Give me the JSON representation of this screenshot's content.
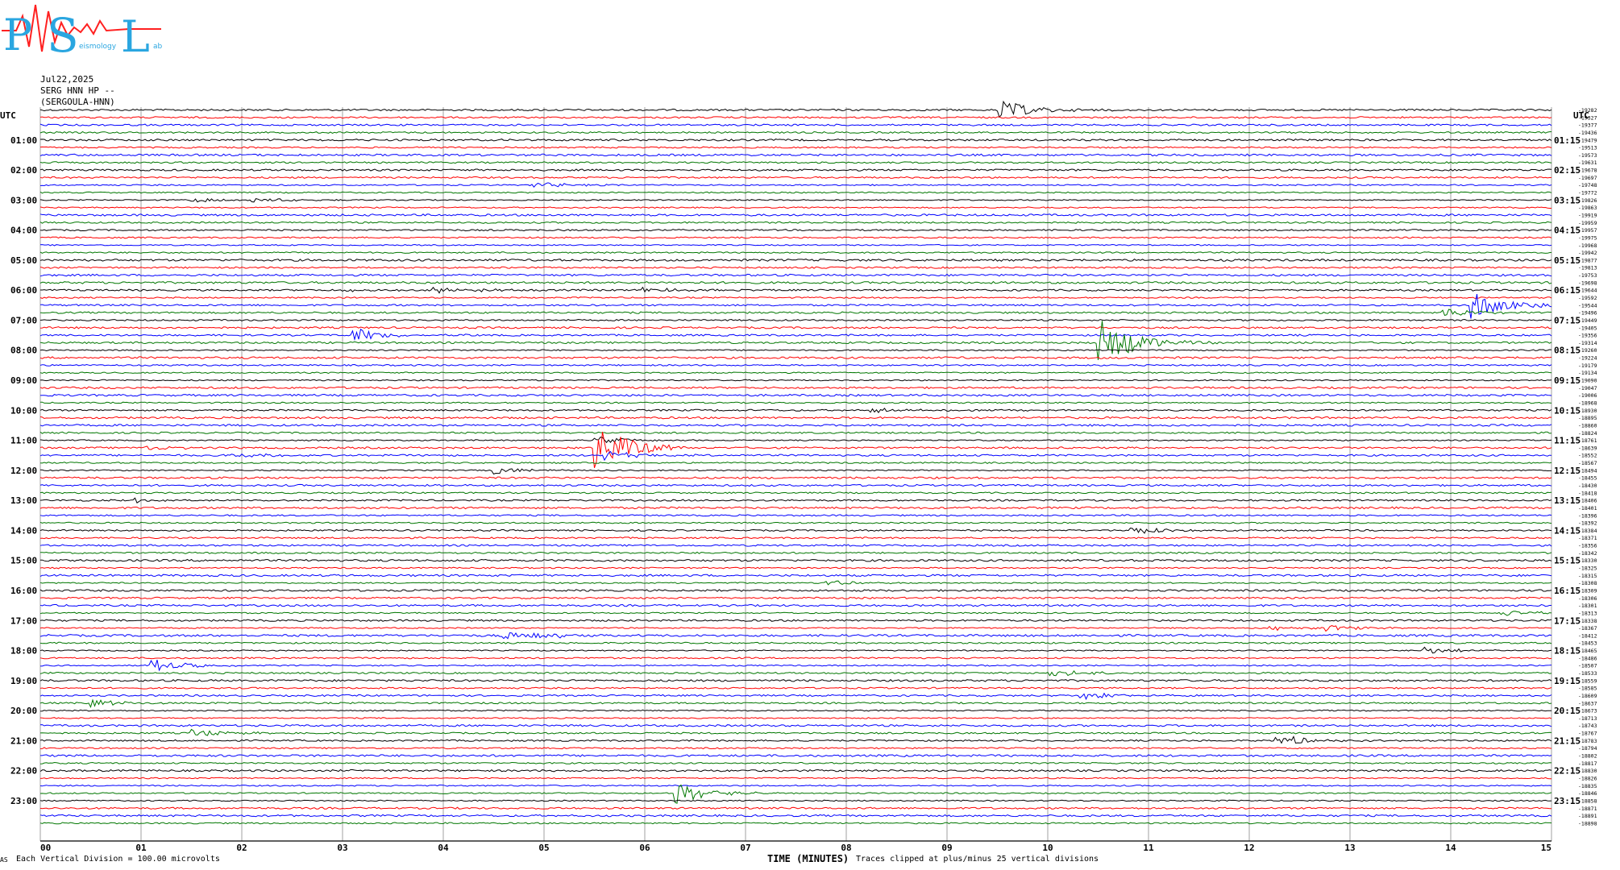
{
  "header": {
    "date": "Jul22,2025",
    "station": "SERG HNN HP --",
    "station_name": "(SERGOULA-HNN)"
  },
  "logo": {
    "letters": "PSL",
    "subtitle_fragments": [
      "eismology",
      "ab"
    ]
  },
  "footer": {
    "scale_note": "Each Vertical Division = 100.00 microvolts",
    "clip_note": "Traces clipped at plus/minus 25 vertical divisions",
    "corner_mark": "AS"
  },
  "colors": {
    "trace_cycle": [
      "#000000",
      "#ff0000",
      "#0000ff",
      "#007700"
    ],
    "grid": "#a0a0a0",
    "logo_red": "#ff2020",
    "logo_blue": "#2aa6e0"
  },
  "chart_data": {
    "type": "line",
    "chart_kind": "helicorder",
    "xlabel": "TIME (MINUTES)",
    "x_ticks": [
      "00",
      "01",
      "02",
      "03",
      "04",
      "05",
      "06",
      "07",
      "08",
      "09",
      "10",
      "11",
      "12",
      "13",
      "14",
      "15"
    ],
    "xlim": [
      0,
      15
    ],
    "left_axis_title": "UTC",
    "right_axis_title": "UTC",
    "left_time_labels": [
      "01:00",
      "02:00",
      "03:00",
      "04:00",
      "05:00",
      "06:00",
      "07:00",
      "08:00",
      "09:00",
      "10:00",
      "11:00",
      "12:00",
      "13:00",
      "14:00",
      "15:00",
      "16:00",
      "17:00",
      "18:00",
      "19:00",
      "20:00",
      "21:00",
      "22:00",
      "23:00"
    ],
    "right_time_labels": [
      "01:15",
      "02:15",
      "03:15",
      "04:15",
      "05:15",
      "06:15",
      "07:15",
      "08:15",
      "09:15",
      "10:15",
      "11:15",
      "12:15",
      "13:15",
      "14:15",
      "15:15",
      "16:15",
      "17:15",
      "18:15",
      "19:15",
      "20:15",
      "21:15",
      "22:15",
      "23:15"
    ],
    "trace_count": 96,
    "trace_offsets": [
      "-19282",
      "-19327",
      "-19377",
      "-19436",
      "-19479",
      "-19513",
      "-19573",
      "-19631",
      "-19678",
      "-19697",
      "-19748",
      "-19772",
      "-19826",
      "-19863",
      "-19919",
      "-19959",
      "-19957",
      "-19975",
      "-19968",
      "-19942",
      "-19877",
      "-19813",
      "-19753",
      "-19698",
      "-19644",
      "-19592",
      "-19544",
      "-19496",
      "-19449",
      "-19405",
      "-19356",
      "-19314",
      "-19260",
      "-19224",
      "-19179",
      "-19134",
      "-19090",
      "-19047",
      "-19006",
      "-18968",
      "-18930",
      "-18895",
      "-18860",
      "-18824",
      "-18761",
      "-18639",
      "-18552",
      "-18567",
      "-18494",
      "-18455",
      "-18430",
      "-18418",
      "-18406",
      "-18401",
      "-18396",
      "-18392",
      "-18384",
      "-18371",
      "-18356",
      "-18342",
      "-18330",
      "-18325",
      "-18315",
      "-18308",
      "-18309",
      "-18306",
      "-18301",
      "-18313",
      "-18338",
      "-18367",
      "-18412",
      "-18453",
      "-18465",
      "-18486",
      "-18507",
      "-18533",
      "-18559",
      "-18585",
      "-18609",
      "-18637",
      "-18673",
      "-18713",
      "-18743",
      "-18767",
      "-18783",
      "-18794",
      "-18802",
      "-18817",
      "-18830",
      "-18826",
      "-18835",
      "-18846",
      "-18858",
      "-18871",
      "-18891",
      "-18898"
    ],
    "events": [
      {
        "trace": 0,
        "minute": 9.5,
        "amp": 14
      },
      {
        "trace": 10,
        "minute": 4.9,
        "amp": 4
      },
      {
        "trace": 12,
        "minute": 1.5,
        "amp": 3
      },
      {
        "trace": 12,
        "minute": 2.1,
        "amp": 3
      },
      {
        "trace": 24,
        "minute": 3.0,
        "amp": 3
      },
      {
        "trace": 24,
        "minute": 3.9,
        "amp": 4
      },
      {
        "trace": 24,
        "minute": 4.2,
        "amp": 3
      },
      {
        "trace": 24,
        "minute": 5.95,
        "amp": 4
      },
      {
        "trace": 26,
        "minute": 14.2,
        "amp": 18
      },
      {
        "trace": 27,
        "minute": 13.9,
        "amp": 6
      },
      {
        "trace": 30,
        "minute": 3.1,
        "amp": 9
      },
      {
        "trace": 31,
        "minute": 10.5,
        "amp": 34
      },
      {
        "trace": 40,
        "minute": 8.2,
        "amp": 3
      },
      {
        "trace": 44,
        "minute": 5.5,
        "amp": 5
      },
      {
        "trace": 45,
        "minute": 1.0,
        "amp": 3
      },
      {
        "trace": 45,
        "minute": 5.5,
        "amp": 32
      },
      {
        "trace": 46,
        "minute": 5.6,
        "amp": 6
      },
      {
        "trace": 46,
        "minute": 1.9,
        "amp": 4
      },
      {
        "trace": 48,
        "minute": 4.5,
        "amp": 5
      },
      {
        "trace": 52,
        "minute": 0.9,
        "amp": 4
      },
      {
        "trace": 56,
        "minute": 10.8,
        "amp": 5
      },
      {
        "trace": 63,
        "minute": 7.8,
        "amp": 3
      },
      {
        "trace": 67,
        "minute": 14.5,
        "amp": 4
      },
      {
        "trace": 69,
        "minute": 12.2,
        "amp": 4
      },
      {
        "trace": 69,
        "minute": 12.75,
        "amp": 4
      },
      {
        "trace": 70,
        "minute": 4.6,
        "amp": 5
      },
      {
        "trace": 70,
        "minute": 4.9,
        "amp": 4
      },
      {
        "trace": 72,
        "minute": 13.7,
        "amp": 5
      },
      {
        "trace": 74,
        "minute": 1.1,
        "amp": 8
      },
      {
        "trace": 75,
        "minute": 10.0,
        "amp": 5
      },
      {
        "trace": 78,
        "minute": 10.3,
        "amp": 5
      },
      {
        "trace": 79,
        "minute": 0.5,
        "amp": 5
      },
      {
        "trace": 83,
        "minute": 1.5,
        "amp": 5
      },
      {
        "trace": 84,
        "minute": 12.25,
        "amp": 8
      },
      {
        "trace": 91,
        "minute": 6.3,
        "amp": 14
      }
    ]
  }
}
